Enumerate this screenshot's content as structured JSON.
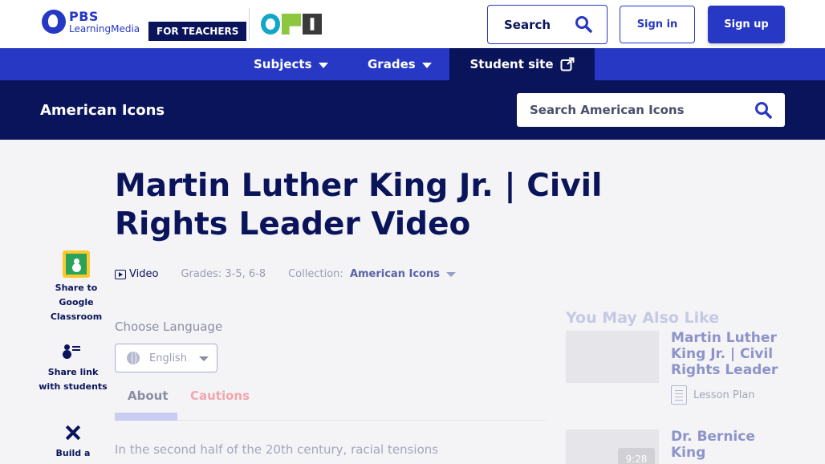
{
  "header": {
    "logo": {
      "brand": "PBS",
      "product": "LearningMedia"
    },
    "teachers_badge": "FOR TEACHERS",
    "partner_logo_icon": "opb-logo",
    "search_label": "Search",
    "signin_label": "Sign in",
    "signup_label": "Sign up"
  },
  "nav": {
    "items": [
      {
        "label": "Subjects"
      },
      {
        "label": "Grades"
      },
      {
        "label": "Student site"
      }
    ]
  },
  "collection_bar": {
    "title": "American Icons",
    "search_placeholder": "Search American Icons"
  },
  "resource": {
    "title": "Martin Luther King Jr. | Civil Rights Leader Video",
    "type": "Video",
    "grades_label": "Grades:",
    "grades_value": "3-5, 6-8",
    "collection_label": "Collection:",
    "collection_value": "American Icons"
  },
  "share_rail": [
    {
      "label": "Share to Google Classroom",
      "icon": "google-classroom-icon"
    },
    {
      "label": "Share link with students",
      "icon": "share-students-icon"
    },
    {
      "label": "Build a",
      "icon": "build-tools-icon"
    }
  ],
  "language": {
    "label": "Choose Language",
    "selected": "English"
  },
  "tabs": [
    {
      "label": "About",
      "active": true
    },
    {
      "label": "Cautions",
      "active": false
    }
  ],
  "description_start": "In the second half of the 20th century, racial tensions",
  "related": {
    "heading": "You May Also Like",
    "items": [
      {
        "title": "Martin Luther King Jr. | Civil Rights Leader",
        "type": "Lesson Plan"
      },
      {
        "title": "Dr. Bernice King",
        "duration": "9:28"
      }
    ]
  },
  "colors": {
    "primary": "#2638c4",
    "navy": "#0a145a",
    "page_bg": "#f4f4f7",
    "cautions": "#f2a6ad"
  }
}
